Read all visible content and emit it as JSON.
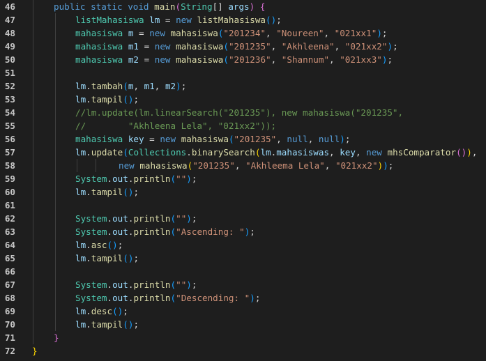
{
  "line_numbers": [
    "46",
    "47",
    "48",
    "49",
    "50",
    "51",
    "52",
    "53",
    "54",
    "55",
    "56",
    "57",
    "58",
    "59",
    "60",
    "61",
    "62",
    "63",
    "64",
    "65",
    "66",
    "67",
    "68",
    "69",
    "70",
    "71",
    "72"
  ],
  "colors": {
    "background": "#1e1e1e",
    "keyword": "#569cd6",
    "type": "#4ec9b0",
    "function": "#dcdcaa",
    "variable": "#9cdcfe",
    "string": "#ce9178",
    "comment": "#6a9955",
    "bracket_gold": "#ffd700",
    "bracket_purple": "#da70d6"
  },
  "lines": [
    {
      "n": "46",
      "indent": 1,
      "tokens": [
        [
          "kw",
          "public"
        ],
        [
          "pl",
          " "
        ],
        [
          "kw",
          "static"
        ],
        [
          "pl",
          " "
        ],
        [
          "kw",
          "void"
        ],
        [
          "pl",
          " "
        ],
        [
          "fn",
          "main"
        ],
        [
          "br2",
          "("
        ],
        [
          "ty",
          "String"
        ],
        [
          "pl",
          "[] "
        ],
        [
          "var",
          "args"
        ],
        [
          "br2",
          ")"
        ],
        [
          "pl",
          " "
        ],
        [
          "br2",
          "{"
        ]
      ]
    },
    {
      "n": "47",
      "indent": 2,
      "tokens": [
        [
          "ty",
          "listMahasiswa"
        ],
        [
          "pl",
          " "
        ],
        [
          "var",
          "lm"
        ],
        [
          "pl",
          " = "
        ],
        [
          "kw",
          "new"
        ],
        [
          "pl",
          " "
        ],
        [
          "fn",
          "listMahasiswa"
        ],
        [
          "br3",
          "()"
        ],
        [
          "pl",
          ";"
        ]
      ]
    },
    {
      "n": "48",
      "indent": 2,
      "tokens": [
        [
          "ty",
          "mahasiswa"
        ],
        [
          "pl",
          " "
        ],
        [
          "var",
          "m"
        ],
        [
          "pl",
          " = "
        ],
        [
          "kw",
          "new"
        ],
        [
          "pl",
          " "
        ],
        [
          "fn",
          "mahasiswa"
        ],
        [
          "br3",
          "("
        ],
        [
          "str",
          "\"201234\""
        ],
        [
          "pl",
          ", "
        ],
        [
          "str",
          "\"Noureen\""
        ],
        [
          "pl",
          ", "
        ],
        [
          "str",
          "\"021xx1\""
        ],
        [
          "br3",
          ")"
        ],
        [
          "pl",
          ";"
        ]
      ]
    },
    {
      "n": "49",
      "indent": 2,
      "tokens": [
        [
          "ty",
          "mahasiswa"
        ],
        [
          "pl",
          " "
        ],
        [
          "var",
          "m1"
        ],
        [
          "pl",
          " = "
        ],
        [
          "kw",
          "new"
        ],
        [
          "pl",
          " "
        ],
        [
          "fn",
          "mahasiswa"
        ],
        [
          "br3",
          "("
        ],
        [
          "str",
          "\"201235\""
        ],
        [
          "pl",
          ", "
        ],
        [
          "str",
          "\"Akhleena\""
        ],
        [
          "pl",
          ", "
        ],
        [
          "str",
          "\"021xx2\""
        ],
        [
          "br3",
          ")"
        ],
        [
          "pl",
          ";"
        ]
      ]
    },
    {
      "n": "50",
      "indent": 2,
      "tokens": [
        [
          "ty",
          "mahasiswa"
        ],
        [
          "pl",
          " "
        ],
        [
          "var",
          "m2"
        ],
        [
          "pl",
          " = "
        ],
        [
          "kw",
          "new"
        ],
        [
          "pl",
          " "
        ],
        [
          "fn",
          "mahasiswa"
        ],
        [
          "br3",
          "("
        ],
        [
          "str",
          "\"201236\""
        ],
        [
          "pl",
          ", "
        ],
        [
          "str",
          "\"Shannum\""
        ],
        [
          "pl",
          ", "
        ],
        [
          "str",
          "\"021xx3\""
        ],
        [
          "br3",
          ")"
        ],
        [
          "pl",
          ";"
        ]
      ]
    },
    {
      "n": "51",
      "indent": 2,
      "tokens": []
    },
    {
      "n": "52",
      "indent": 2,
      "tokens": [
        [
          "var",
          "lm"
        ],
        [
          "pl",
          "."
        ],
        [
          "fn",
          "tambah"
        ],
        [
          "br3",
          "("
        ],
        [
          "var",
          "m"
        ],
        [
          "pl",
          ", "
        ],
        [
          "var",
          "m1"
        ],
        [
          "pl",
          ", "
        ],
        [
          "var",
          "m2"
        ],
        [
          "br3",
          ")"
        ],
        [
          "pl",
          ";"
        ]
      ]
    },
    {
      "n": "53",
      "indent": 2,
      "tokens": [
        [
          "var",
          "lm"
        ],
        [
          "pl",
          "."
        ],
        [
          "fn",
          "tampil"
        ],
        [
          "br3",
          "()"
        ],
        [
          "pl",
          ";"
        ]
      ]
    },
    {
      "n": "54",
      "indent": 2,
      "tokens": [
        [
          "cm",
          "//lm.update(lm.linearSearch(\"201235\"), new mahasiswa(\"201235\","
        ]
      ]
    },
    {
      "n": "55",
      "indent": 2,
      "tokens": [
        [
          "cm",
          "//        \"Akhleena Lela\", \"021xx2\"));"
        ]
      ]
    },
    {
      "n": "56",
      "indent": 2,
      "tokens": [
        [
          "ty",
          "mahasiswa"
        ],
        [
          "pl",
          " "
        ],
        [
          "var",
          "key"
        ],
        [
          "pl",
          " = "
        ],
        [
          "kw",
          "new"
        ],
        [
          "pl",
          " "
        ],
        [
          "fn",
          "mahasiswa"
        ],
        [
          "br3",
          "("
        ],
        [
          "str",
          "\"201235\""
        ],
        [
          "pl",
          ", "
        ],
        [
          "kw",
          "null"
        ],
        [
          "pl",
          ", "
        ],
        [
          "kw",
          "null"
        ],
        [
          "br3",
          ")"
        ],
        [
          "pl",
          ";"
        ]
      ]
    },
    {
      "n": "57",
      "indent": 2,
      "tokens": [
        [
          "var",
          "lm"
        ],
        [
          "pl",
          "."
        ],
        [
          "fn",
          "update"
        ],
        [
          "br3",
          "("
        ],
        [
          "ty",
          "Collections"
        ],
        [
          "pl",
          "."
        ],
        [
          "fn",
          "binarySearch"
        ],
        [
          "br1",
          "("
        ],
        [
          "var",
          "lm"
        ],
        [
          "pl",
          "."
        ],
        [
          "var",
          "mahasiswas"
        ],
        [
          "pl",
          ", "
        ],
        [
          "var",
          "key"
        ],
        [
          "pl",
          ", "
        ],
        [
          "kw",
          "new"
        ],
        [
          "pl",
          " "
        ],
        [
          "fn",
          "mhsComparator"
        ],
        [
          "br2",
          "()"
        ],
        [
          "br1",
          ")"
        ],
        [
          "pl",
          ","
        ]
      ]
    },
    {
      "n": "58",
      "indent": 4,
      "tokens": [
        [
          "kw",
          "new"
        ],
        [
          "pl",
          " "
        ],
        [
          "fn",
          "mahasiswa"
        ],
        [
          "br1",
          "("
        ],
        [
          "str",
          "\"201235\""
        ],
        [
          "pl",
          ", "
        ],
        [
          "str",
          "\"Akhleema Lela\""
        ],
        [
          "pl",
          ", "
        ],
        [
          "str",
          "\"021xx2\""
        ],
        [
          "br1",
          ")"
        ],
        [
          "br3",
          ")"
        ],
        [
          "pl",
          ";"
        ]
      ]
    },
    {
      "n": "59",
      "indent": 2,
      "tokens": [
        [
          "ty",
          "System"
        ],
        [
          "pl",
          "."
        ],
        [
          "var",
          "out"
        ],
        [
          "pl",
          "."
        ],
        [
          "fn",
          "println"
        ],
        [
          "br3",
          "("
        ],
        [
          "str",
          "\"\""
        ],
        [
          "br3",
          ")"
        ],
        [
          "pl",
          ";"
        ]
      ]
    },
    {
      "n": "60",
      "indent": 2,
      "tokens": [
        [
          "var",
          "lm"
        ],
        [
          "pl",
          "."
        ],
        [
          "fn",
          "tampil"
        ],
        [
          "br3",
          "()"
        ],
        [
          "pl",
          ";"
        ]
      ]
    },
    {
      "n": "61",
      "indent": 2,
      "tokens": []
    },
    {
      "n": "62",
      "indent": 2,
      "tokens": [
        [
          "ty",
          "System"
        ],
        [
          "pl",
          "."
        ],
        [
          "var",
          "out"
        ],
        [
          "pl",
          "."
        ],
        [
          "fn",
          "println"
        ],
        [
          "br3",
          "("
        ],
        [
          "str",
          "\"\""
        ],
        [
          "br3",
          ")"
        ],
        [
          "pl",
          ";"
        ]
      ]
    },
    {
      "n": "63",
      "indent": 2,
      "tokens": [
        [
          "ty",
          "System"
        ],
        [
          "pl",
          "."
        ],
        [
          "var",
          "out"
        ],
        [
          "pl",
          "."
        ],
        [
          "fn",
          "println"
        ],
        [
          "br3",
          "("
        ],
        [
          "str",
          "\"Ascending: \""
        ],
        [
          "br3",
          ")"
        ],
        [
          "pl",
          ";"
        ]
      ]
    },
    {
      "n": "64",
      "indent": 2,
      "tokens": [
        [
          "var",
          "lm"
        ],
        [
          "pl",
          "."
        ],
        [
          "fn",
          "asc"
        ],
        [
          "br3",
          "()"
        ],
        [
          "pl",
          ";"
        ]
      ]
    },
    {
      "n": "65",
      "indent": 2,
      "tokens": [
        [
          "var",
          "lm"
        ],
        [
          "pl",
          "."
        ],
        [
          "fn",
          "tampil"
        ],
        [
          "br3",
          "()"
        ],
        [
          "pl",
          ";"
        ]
      ]
    },
    {
      "n": "66",
      "indent": 2,
      "tokens": []
    },
    {
      "n": "67",
      "indent": 2,
      "tokens": [
        [
          "ty",
          "System"
        ],
        [
          "pl",
          "."
        ],
        [
          "var",
          "out"
        ],
        [
          "pl",
          "."
        ],
        [
          "fn",
          "println"
        ],
        [
          "br3",
          "("
        ],
        [
          "str",
          "\"\""
        ],
        [
          "br3",
          ")"
        ],
        [
          "pl",
          ";"
        ]
      ]
    },
    {
      "n": "68",
      "indent": 2,
      "tokens": [
        [
          "ty",
          "System"
        ],
        [
          "pl",
          "."
        ],
        [
          "var",
          "out"
        ],
        [
          "pl",
          "."
        ],
        [
          "fn",
          "println"
        ],
        [
          "br3",
          "("
        ],
        [
          "str",
          "\"Descending: \""
        ],
        [
          "br3",
          ")"
        ],
        [
          "pl",
          ";"
        ]
      ]
    },
    {
      "n": "69",
      "indent": 2,
      "tokens": [
        [
          "var",
          "lm"
        ],
        [
          "pl",
          "."
        ],
        [
          "fn",
          "desc"
        ],
        [
          "br3",
          "()"
        ],
        [
          "pl",
          ";"
        ]
      ]
    },
    {
      "n": "70",
      "indent": 2,
      "tokens": [
        [
          "var",
          "lm"
        ],
        [
          "pl",
          "."
        ],
        [
          "fn",
          "tampil"
        ],
        [
          "br3",
          "()"
        ],
        [
          "pl",
          ";"
        ]
      ]
    },
    {
      "n": "71",
      "indent": 1,
      "tokens": [
        [
          "br2",
          "}"
        ]
      ]
    },
    {
      "n": "72",
      "indent": 0,
      "tokens": [
        [
          "br1",
          "}"
        ]
      ]
    }
  ]
}
